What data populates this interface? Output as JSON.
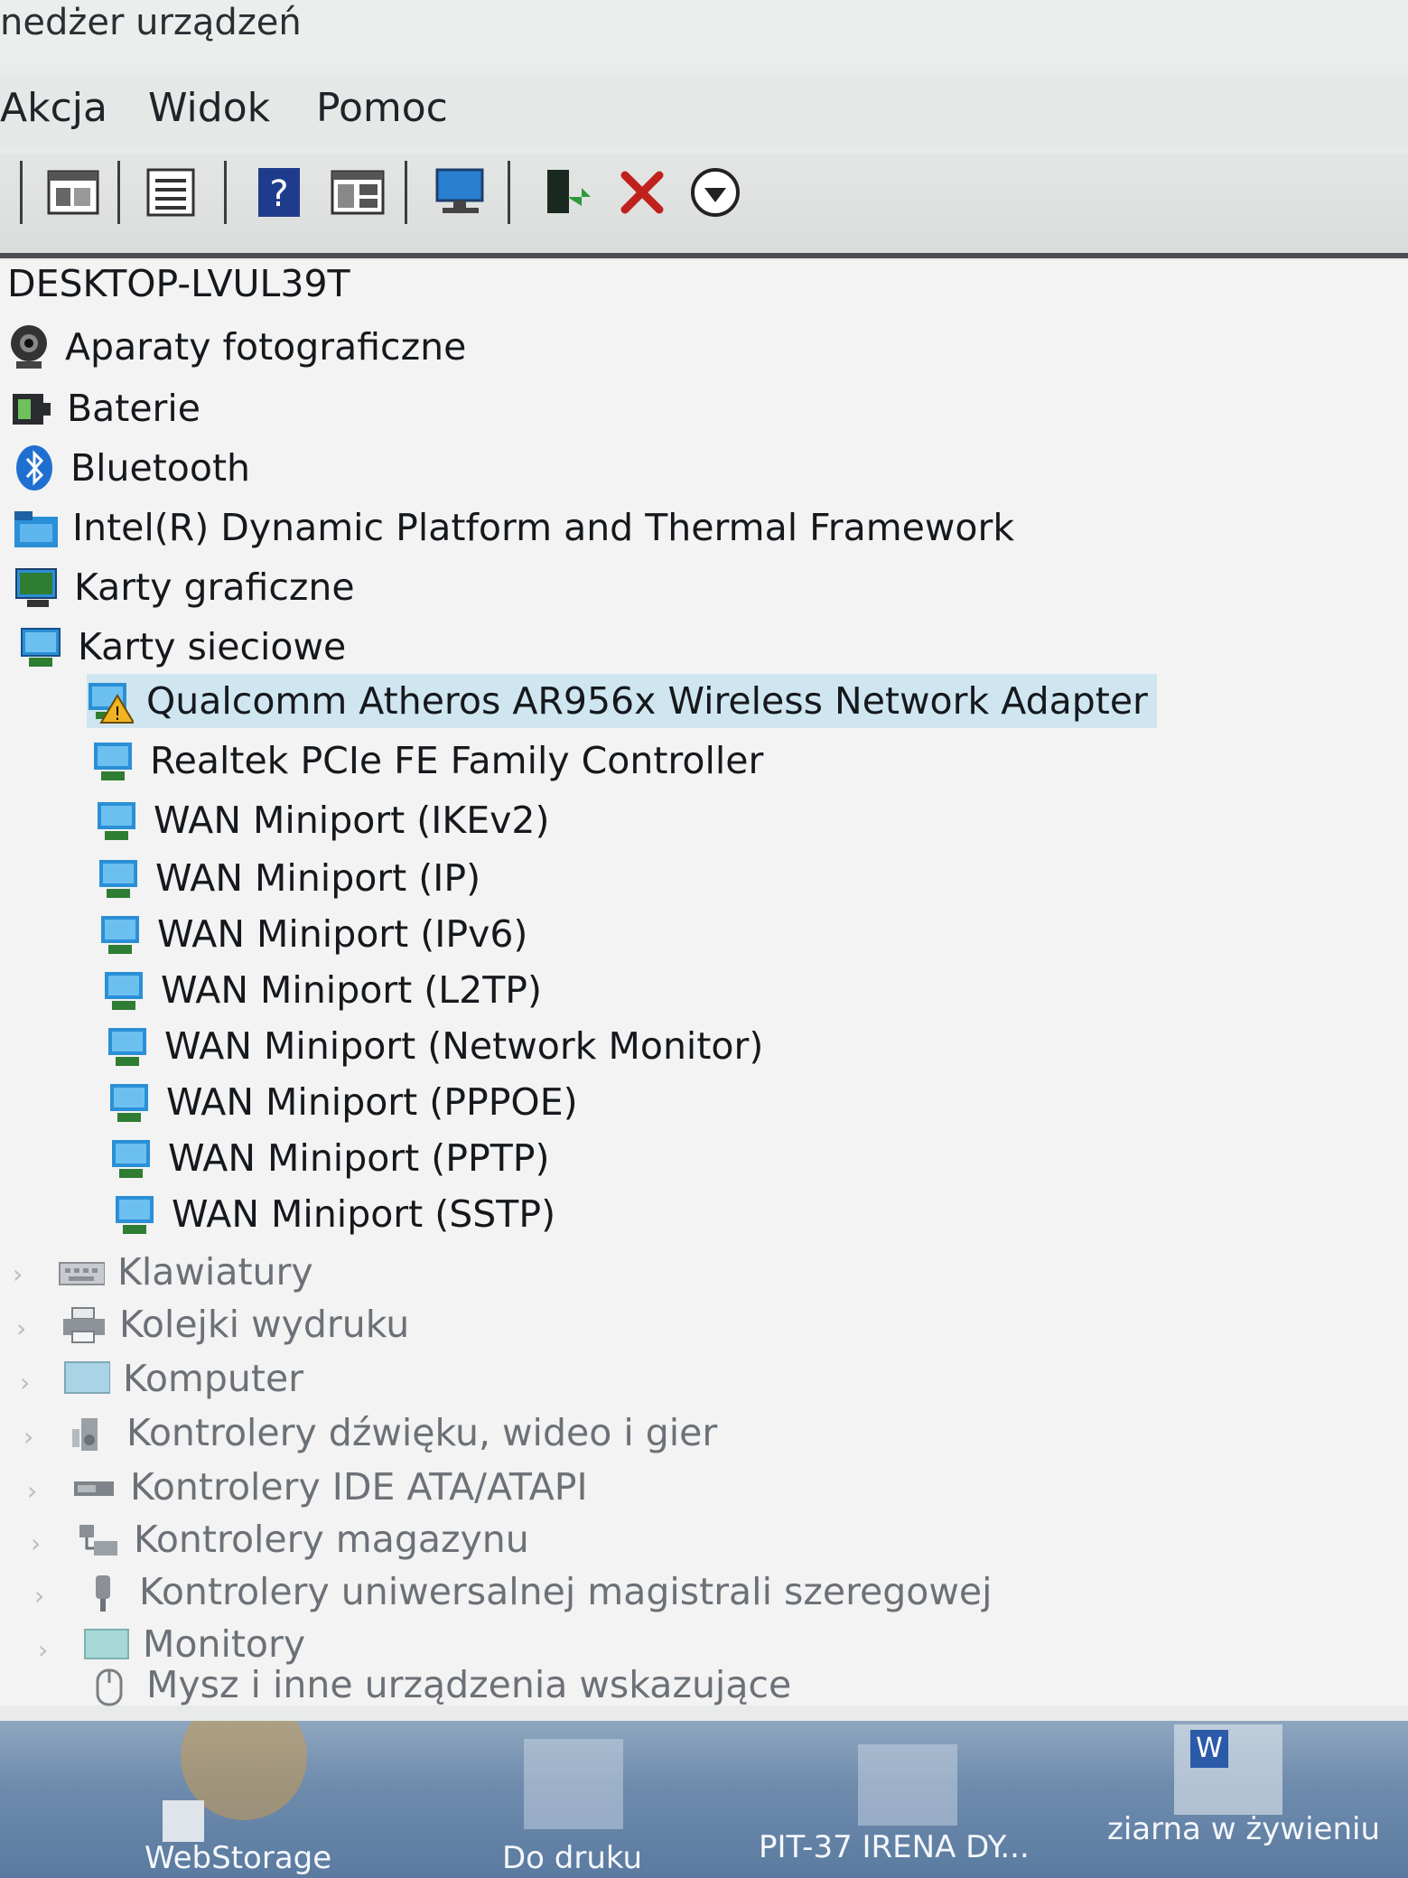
{
  "window": {
    "title": "nedżer urządzeń"
  },
  "menu": [
    "Akcja",
    "Widok",
    "Pomoc"
  ],
  "toolbar": [
    {
      "name": "properties-window-icon"
    },
    {
      "name": "details-list-icon"
    },
    {
      "name": "help-icon"
    },
    {
      "name": "view-icon"
    },
    {
      "name": "monitor-scan-icon"
    },
    {
      "name": "add-driver-icon"
    },
    {
      "name": "uninstall-x-icon"
    },
    {
      "name": "download-update-icon"
    }
  ],
  "tree": {
    "root": "DESKTOP-LVUL39T",
    "categories": [
      {
        "label": "Aparaty fotograficzne",
        "icon": "camera-icon"
      },
      {
        "label": "Baterie",
        "icon": "battery-icon"
      },
      {
        "label": "Bluetooth",
        "icon": "bluetooth-icon"
      },
      {
        "label": "Intel(R) Dynamic Platform and Thermal Framework",
        "icon": "folder-device-icon"
      },
      {
        "label": "Karty graficzne",
        "icon": "display-adapter-icon"
      },
      {
        "label": "Karty sieciowe",
        "icon": "network-adapter-icon"
      }
    ],
    "network_children": [
      "Qualcomm Atheros AR956x Wireless Network Adapter",
      "Realtek PCIe FE Family Controller",
      "WAN Miniport (IKEv2)",
      "WAN Miniport (IP)",
      "WAN Miniport (IPv6)",
      "WAN Miniport (L2TP)",
      "WAN Miniport (Network Monitor)",
      "WAN Miniport (PPPOE)",
      "WAN Miniport (PPTP)",
      "WAN Miniport (SSTP)"
    ],
    "more_categories": [
      {
        "label": "Klawiatury",
        "icon": "keyboard-icon"
      },
      {
        "label": "Kolejki wydruku",
        "icon": "printer-icon"
      },
      {
        "label": "Komputer",
        "icon": "computer-icon"
      },
      {
        "label": "Kontrolery dźwięku, wideo i gier",
        "icon": "speaker-icon"
      },
      {
        "label": "Kontrolery IDE ATA/ATAPI",
        "icon": "ide-controller-icon"
      },
      {
        "label": "Kontrolery magazynu",
        "icon": "storage-controller-icon"
      },
      {
        "label": "Kontrolery uniwersalnej magistrali szeregowej",
        "icon": "usb-icon"
      },
      {
        "label": "Monitory",
        "icon": "monitor-icon"
      },
      {
        "label": "Mysz i inne urządzenia wskazujące",
        "icon": "mouse-icon"
      }
    ]
  },
  "taskbar": [
    "WebStorage",
    "Do druku",
    "PIT-37 IRENA DY...",
    "ziarna w żywieniu"
  ],
  "colors": {
    "selection": "#cfe6f0",
    "network_blue": "#2a8fd6",
    "warning": "#f0b323"
  }
}
